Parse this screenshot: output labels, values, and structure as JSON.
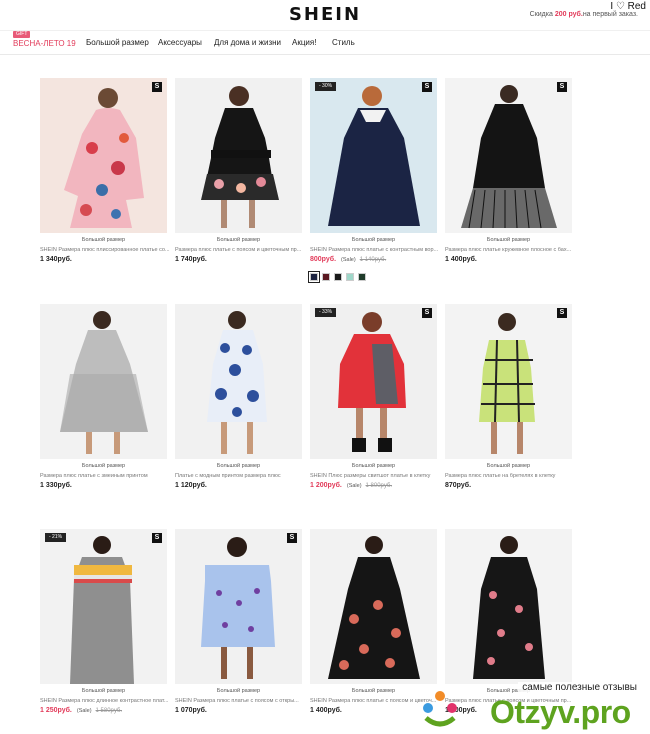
{
  "header": {
    "logo": "SHEIN",
    "promo_prefix": "Скидка ",
    "promo_highlight": "200 руб.",
    "promo_suffix": "на первый заказ.",
    "corner_text": "I ♡ Red"
  },
  "nav": {
    "gift_badge": "GIFT",
    "items": [
      "ВЕСНА-ЛЕТО 19",
      "Большой размер",
      "Аксессуары",
      "Для дома и жизни",
      "Акция!",
      "Стиль"
    ]
  },
  "products": [
    {
      "category": "Большой размер",
      "title": "SHEIN Размера плюс плиссированное платье со...",
      "price": "1 340руб.",
      "badge": "S",
      "discount": ""
    },
    {
      "category": "Большой размер",
      "title": "Размера плюс платье с поясом и цветочным пр...",
      "price": "1 740руб.",
      "badge": "",
      "discount": ""
    },
    {
      "category": "Большой размер",
      "title": "SHEIN Размера плюс платье с контрастным вор...",
      "price": "800руб.",
      "sale_label": "(Sale)",
      "old_price": "1 140руб.",
      "badge": "S",
      "discount": "- 30%"
    },
    {
      "category": "Большой размер",
      "title": "Размера плюс платье кружевное плосное с бах...",
      "price": "1 400руб.",
      "badge": "S",
      "discount": ""
    },
    {
      "category": "Большой размер",
      "title": "Размера плюс платье с змеиным принтом",
      "price": "1 330руб.",
      "badge": "",
      "discount": ""
    },
    {
      "category": "Большой размер",
      "title": "Платье с модным принтом размера плюс",
      "price": "1 120руб.",
      "badge": "",
      "discount": ""
    },
    {
      "category": "Большой размер",
      "title": "SHEIN Плюс размеры свитшот платье в клетку",
      "price": "1 200руб.",
      "sale_label": "(Sale)",
      "old_price": "1 800руб.",
      "badge": "S",
      "discount": "- 33%"
    },
    {
      "category": "Большой размер",
      "title": "Размера плюс платье на бретелях в клетку",
      "price": "870руб.",
      "badge": "S",
      "discount": ""
    },
    {
      "category": "Большой размер",
      "title": "SHEIN Размера плюс длинное контрастное плат...",
      "price": "1 250руб.",
      "sale_label": "(Sale)",
      "old_price": "1 580руб.",
      "badge": "S",
      "discount": "- 21%"
    },
    {
      "category": "Большой размер",
      "title": "SHEIN Размера плюс платье с поясом с откры...",
      "price": "1 070руб.",
      "badge": "S",
      "discount": ""
    },
    {
      "category": "Большой размер",
      "title": "SHEIN Размера плюс платье с поясом и цветоч...",
      "price": "1 400руб.",
      "badge": "",
      "discount": ""
    },
    {
      "category": "Большой размер",
      "title": "Размера плюс платье с поясом и цветочным пр...",
      "price": "1 400руб.",
      "badge": "",
      "discount": ""
    }
  ],
  "swatch_colors": [
    "#1c2340",
    "#5a1820",
    "#1a1a1a",
    "#9fd7c9",
    "#1f3b2a"
  ],
  "watermark": {
    "caption": "самые полезные отзывы",
    "brand": "Otzyv.pro"
  }
}
